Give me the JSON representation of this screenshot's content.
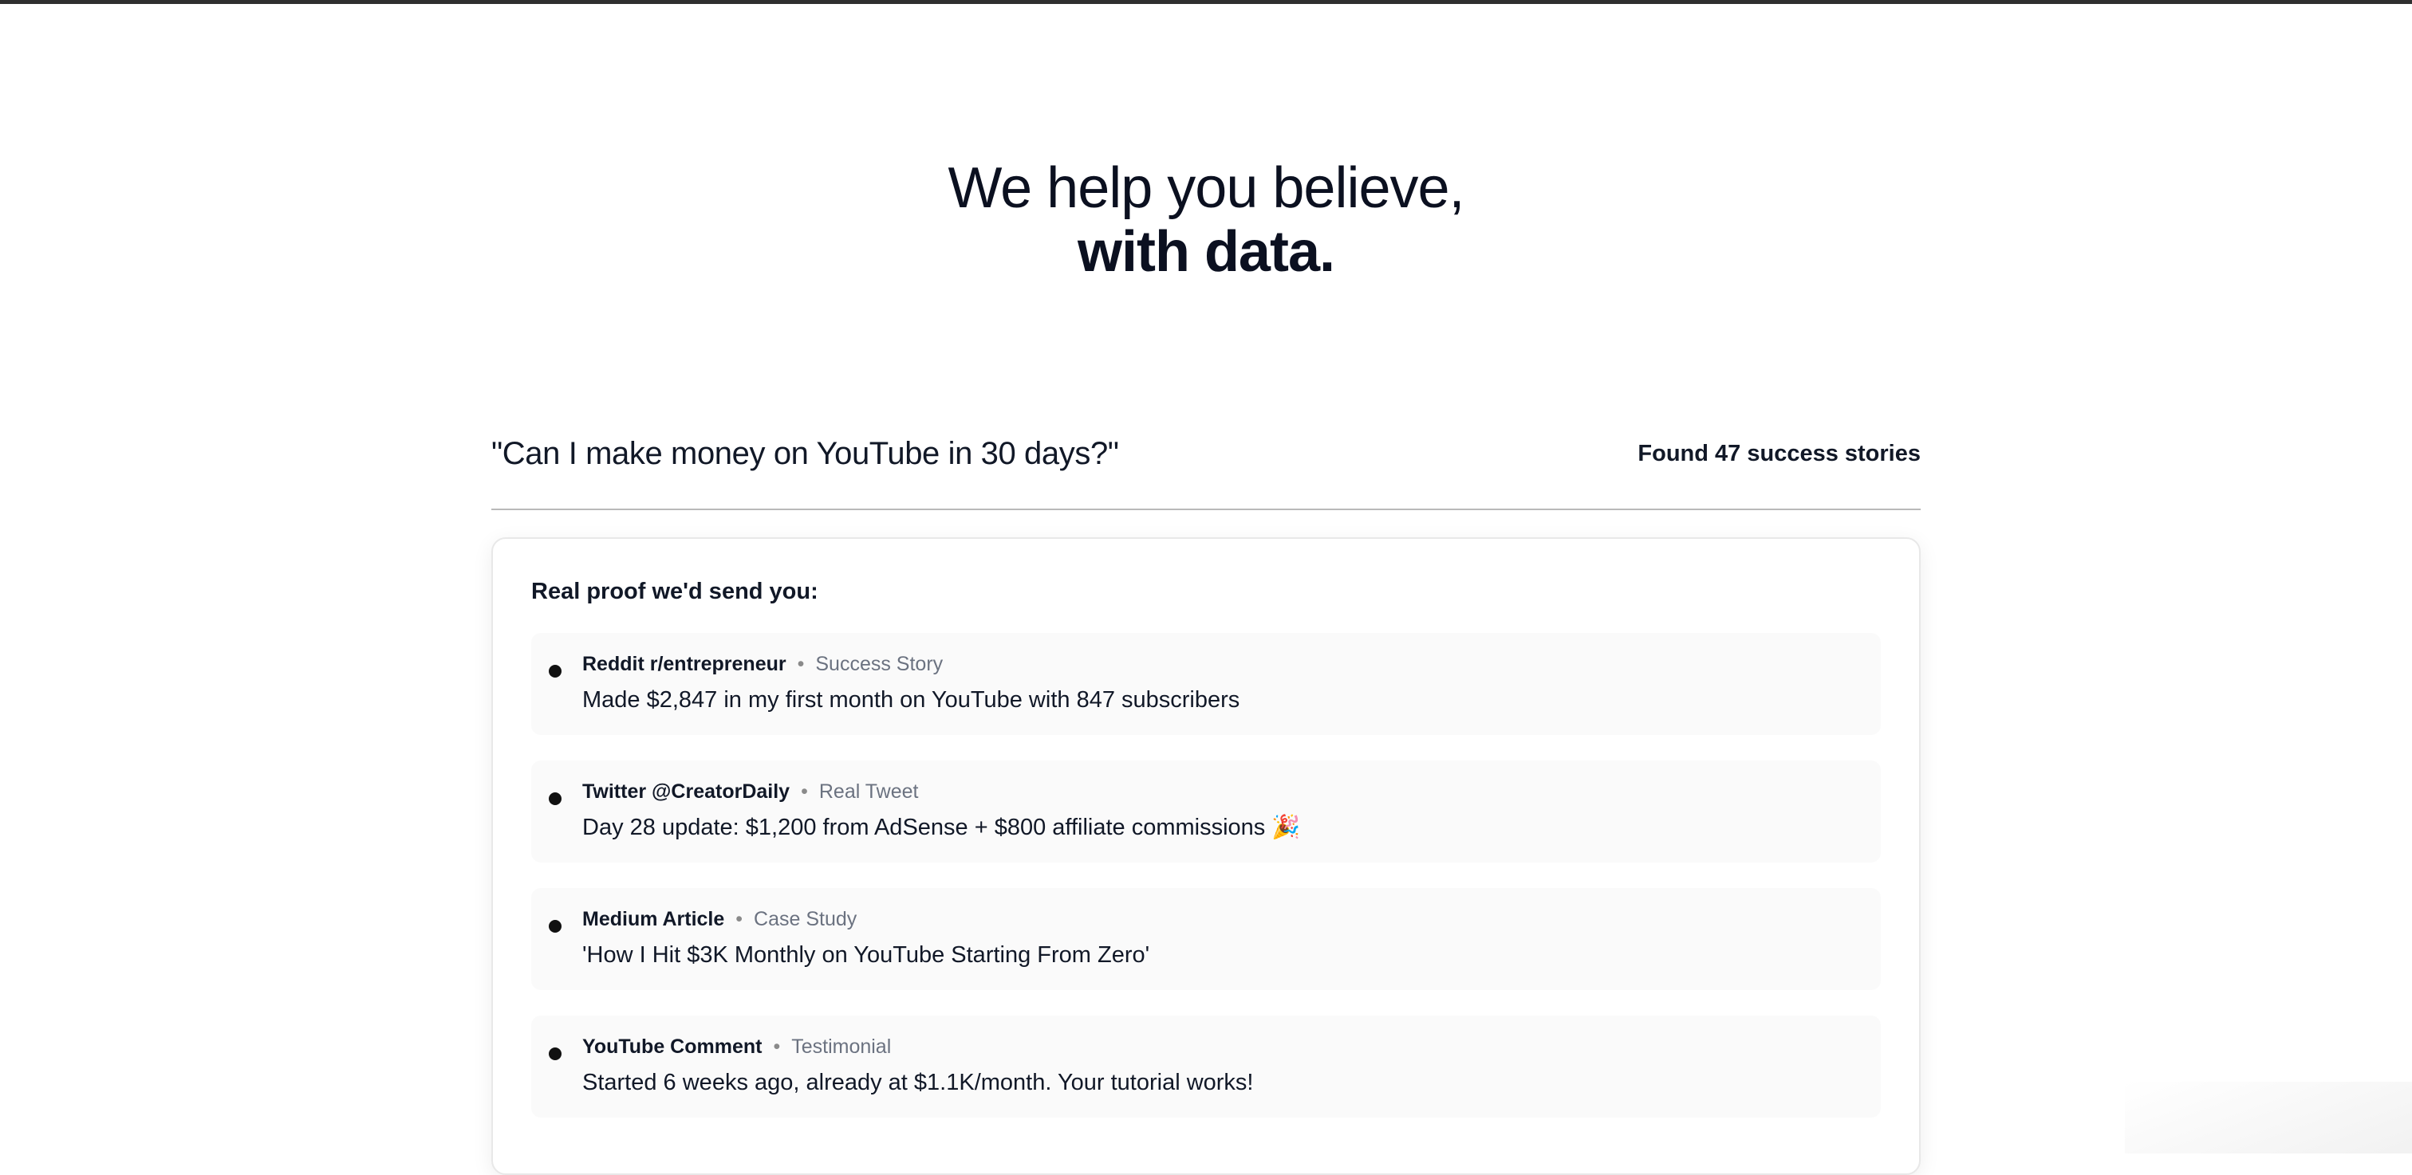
{
  "hero": {
    "line1": "We help you believe,",
    "line2": "with data."
  },
  "query": {
    "text": "\"Can I make money on YouTube in 30 days?\"",
    "found": "Found 47 success stories"
  },
  "proof_card": {
    "title": "Real proof we'd send you:",
    "separator": "•",
    "items": [
      {
        "source": "Reddit r/entrepreneur",
        "type": "Success Story",
        "text": "Made $2,847 in my first month on YouTube with 847 subscribers"
      },
      {
        "source": "Twitter @CreatorDaily",
        "type": "Real Tweet",
        "text": "Day 28 update: $1,200 from AdSense + $800 affiliate commissions 🎉"
      },
      {
        "source": "Medium Article",
        "type": "Case Study",
        "text": "'How I Hit $3K Monthly on YouTube Starting From Zero'"
      },
      {
        "source": "YouTube Comment",
        "type": "Testimonial",
        "text": "Started 6 weeks ago, already at $1.1K/month. Your tutorial works!"
      }
    ]
  }
}
